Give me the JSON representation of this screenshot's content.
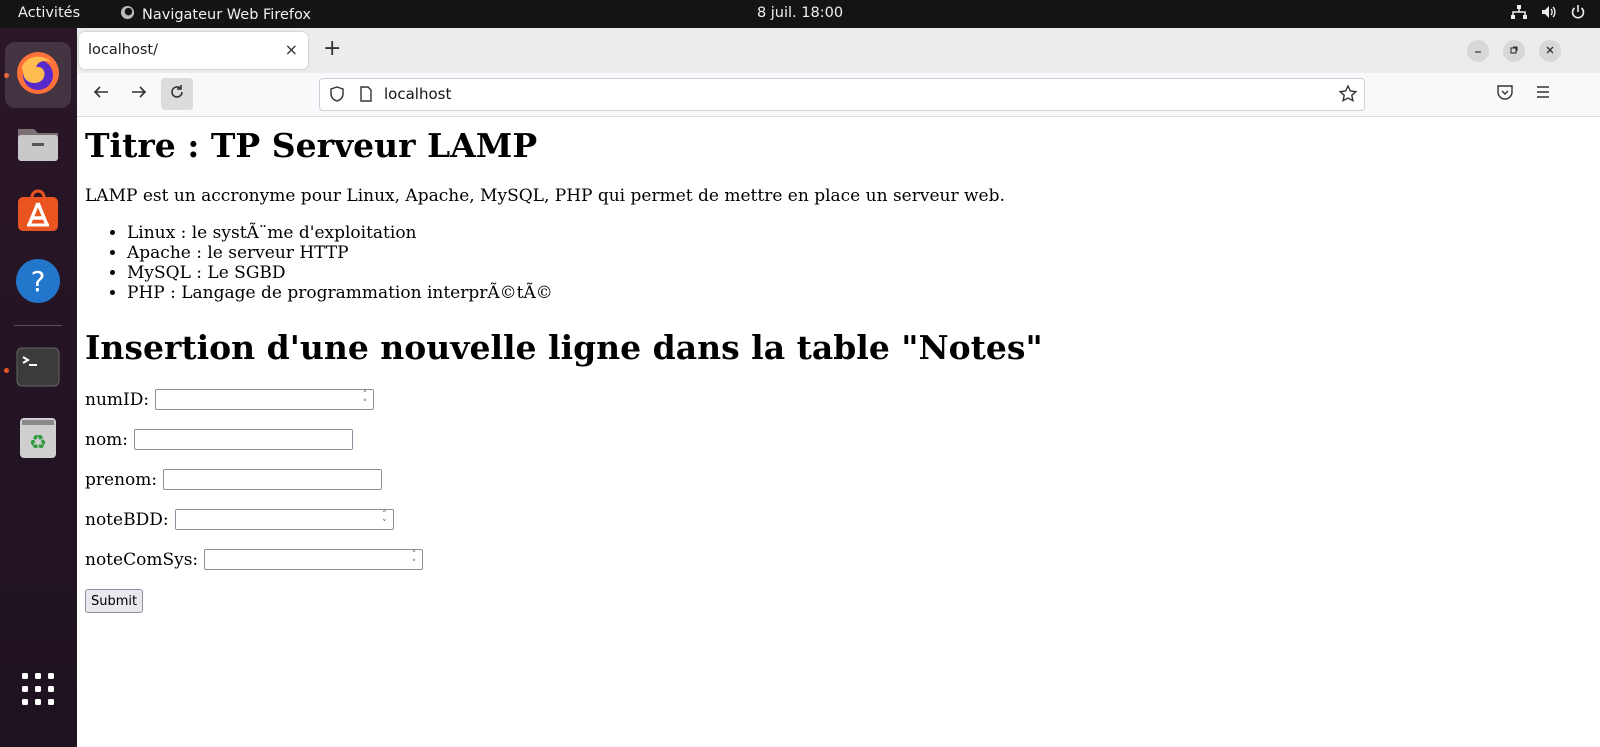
{
  "topbar": {
    "activities": "Activités",
    "app_name": "Navigateur Web Firefox",
    "clock": "8 juil.  18:00"
  },
  "dock": {
    "items": [
      "firefox-icon",
      "files-icon",
      "software-icon",
      "help-icon",
      "terminal-icon",
      "trash-icon",
      "app-grid-icon"
    ]
  },
  "browser": {
    "tab_title": "localhost/",
    "tab_close": "×",
    "new_tab": "+",
    "url": "localhost"
  },
  "page": {
    "title": "Titre : TP Serveur LAMP",
    "intro": "LAMP est un accronyme pour Linux, Apache, MySQL, PHP qui permet de mettre en place un serveur web.",
    "list": [
      "Linux : le systÃ¨me d'exploitation",
      "Apache : le serveur HTTP",
      "MySQL : Le SGBD",
      "PHP : Langage de programmation interprÃ©tÃ©"
    ],
    "form_title": "Insertion d'une nouvelle ligne dans la table \"Notes\"",
    "fields": {
      "numID": "numID:",
      "nom": "nom:",
      "prenom": "prenom:",
      "noteBDD": "noteBDD:",
      "noteComSys": "noteComSys:"
    },
    "submit_label": "Submit"
  },
  "colors": {
    "topbar_bg": "#141414",
    "dock_bg": "#2a1627",
    "accent_orange": "#e95420"
  }
}
